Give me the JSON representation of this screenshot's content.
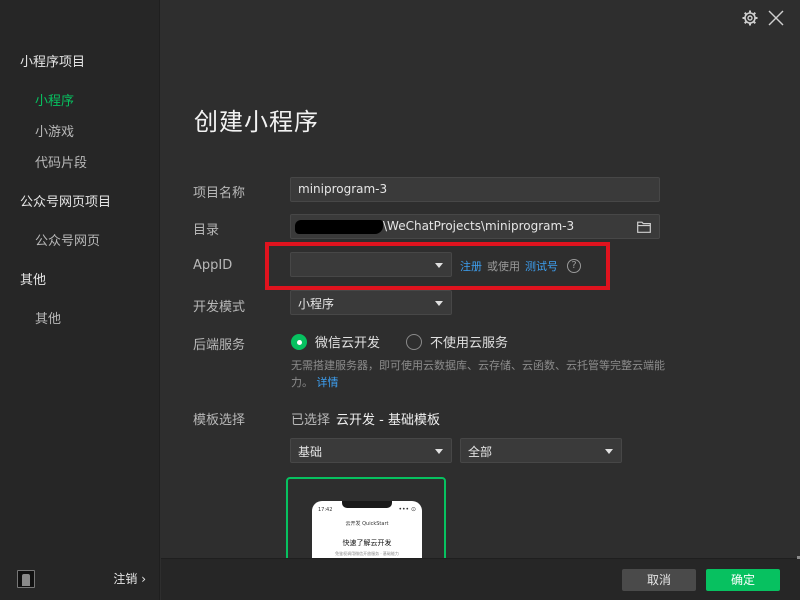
{
  "sidebar": {
    "groups": [
      {
        "label": "小程序项目",
        "items": [
          "小程序",
          "小游戏",
          "代码片段"
        ]
      },
      {
        "label": "公众号网页项目",
        "items": [
          "公众号网页"
        ]
      },
      {
        "label": "其他",
        "items": [
          "其他"
        ]
      }
    ],
    "active_item": "小程序",
    "logout_label": "注销 ›"
  },
  "page": {
    "title": "创建小程序"
  },
  "form": {
    "name_label": "项目名称",
    "name_value": "miniprogram-3",
    "dir_label": "目录",
    "dir_value": "\\WeChatProjects\\miniprogram-3",
    "appid_label": "AppID",
    "appid_value": "",
    "register_link": "注册",
    "or_use_text": "或使用",
    "test_account_link": "测试号",
    "help_icon": "?",
    "devmode_label": "开发模式",
    "devmode_value": "小程序",
    "backend_label": "后端服务",
    "backend_option_cloud": "微信云开发",
    "backend_option_none": "不使用云服务",
    "backend_selected": "微信云开发",
    "backend_desc": "无需搭建服务器，即可使用云数据库、云存储、云函数、云托管等完整云端能力。",
    "details_link": "详情",
    "template_label": "模板选择",
    "template_selected_prefix": "已选择",
    "template_selected_name": "云开发 - 基础模板",
    "template_filter_1": "基础",
    "template_filter_2": "全部"
  },
  "template_preview": {
    "time": "17:42",
    "nav": "云开发 QuickStart",
    "capsule": "••• ⊙",
    "heading": "快速了解云开发",
    "sub": "免鉴权调用微信开放服务 · 基础能力"
  },
  "footer": {
    "cancel_label": "取消",
    "ok_label": "确定"
  },
  "colors": {
    "accent": "#07c160",
    "link": "#3d9ff0",
    "highlight": "#e0131e",
    "background": "#2e2e2e",
    "sidebar": "#262626"
  },
  "icons": {
    "settings": "gear-icon",
    "close": "close-icon",
    "folder": "folder-icon",
    "dropdown": "chevron-down-icon",
    "help": "help-icon"
  }
}
